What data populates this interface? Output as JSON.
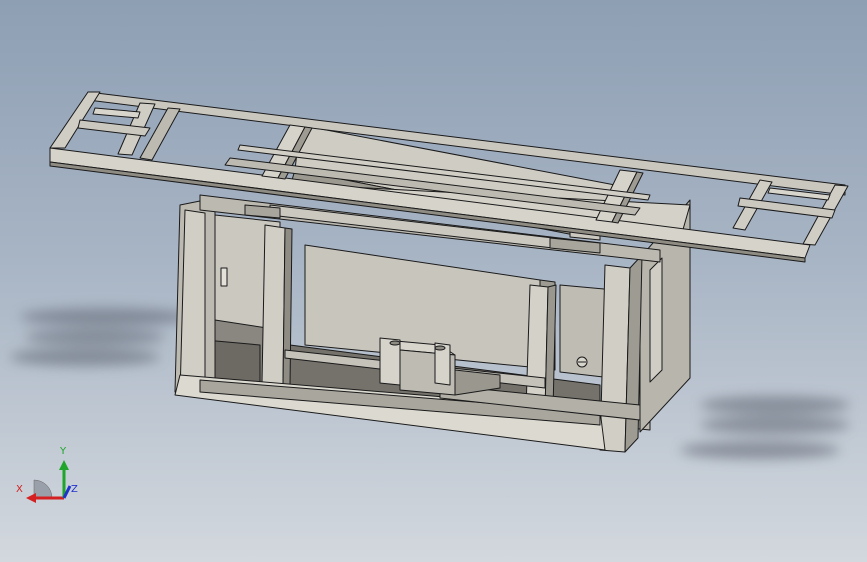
{
  "viewport": {
    "background_top": "#8e9fb4",
    "background_bottom": "#d3d8de"
  },
  "model": {
    "icon": "cad-assembly-frame",
    "body_color": "#c8c5bd",
    "edge_color": "#1a1a1a",
    "shadow_color": "#5f6570"
  },
  "triad": {
    "x_label": "X",
    "y_label": "Y",
    "z_label": "Z",
    "x_color": "#d42020",
    "y_color": "#1ea52a",
    "z_color": "#2233cc"
  }
}
